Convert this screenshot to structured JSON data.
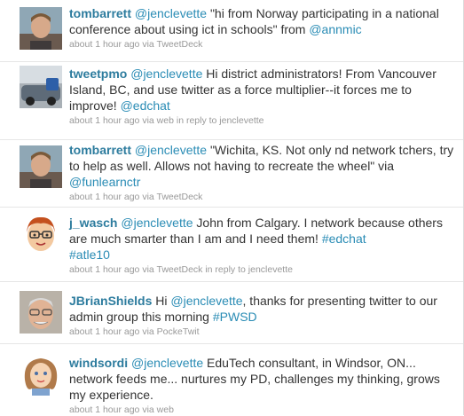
{
  "tweets": [
    {
      "screen_name": "tombarrett",
      "text_1": "@jenclevette",
      "text_2": " \"hi from Norway participating in a national conference about using ict in schools\" from ",
      "text_3": "@annmic",
      "time": "about 1 hour ago",
      "via_label": " via ",
      "source": "TweetDeck"
    },
    {
      "screen_name": "tweetpmo",
      "text_1": "@jenclevette",
      "text_2": " Hi district administrators! From Vancouver Island, BC, and use twitter as a force multiplier--it forces me to improve! ",
      "text_3": "@edchat",
      "time": "about 1 hour ago",
      "via_label": " via ",
      "source": "web",
      "reply_label": " in reply to ",
      "reply_to": "jenclevette"
    },
    {
      "screen_name": "tombarrett",
      "text_1": "@jenclevette",
      "text_2": " \"Wichita, KS. Not only nd network tchers, try to help as well. Allows not having to recreate the wheel\" via ",
      "text_3": "@funlearnctr",
      "time": "about 1 hour ago",
      "via_label": " via ",
      "source": "TweetDeck"
    },
    {
      "screen_name": "j_wasch",
      "text_1": "@jenclevette",
      "text_2": " John from Calgary. I network because others are much smarter than I am and I need them! ",
      "text_3": "#edchat",
      "text_4": "#atle10",
      "time": "about 1 hour ago",
      "via_label": " via ",
      "source": "TweetDeck",
      "reply_label": " in reply to ",
      "reply_to": "jenclevette"
    },
    {
      "screen_name": "JBrianShields",
      "text_pre": " Hi ",
      "text_1": "@jenclevette",
      "text_2": ", thanks for presenting twitter to our admin group this morning ",
      "text_3": "#PWSD",
      "time": "about 1 hour ago",
      "via_label": " via ",
      "source": "PockeTwit"
    },
    {
      "screen_name": "windsordi",
      "text_1": "@jenclevette",
      "text_2": " EduTech consultant, in Windsor, ON... network feeds me... nurtures my PD, challenges my thinking, grows my experience.",
      "time": "about 1 hour ago",
      "via_label": " via ",
      "source": "web"
    }
  ],
  "colors": {
    "screen_name": "#2d7c9e",
    "link": "#2a8cb5",
    "text": "#333333",
    "meta": "#999999"
  }
}
